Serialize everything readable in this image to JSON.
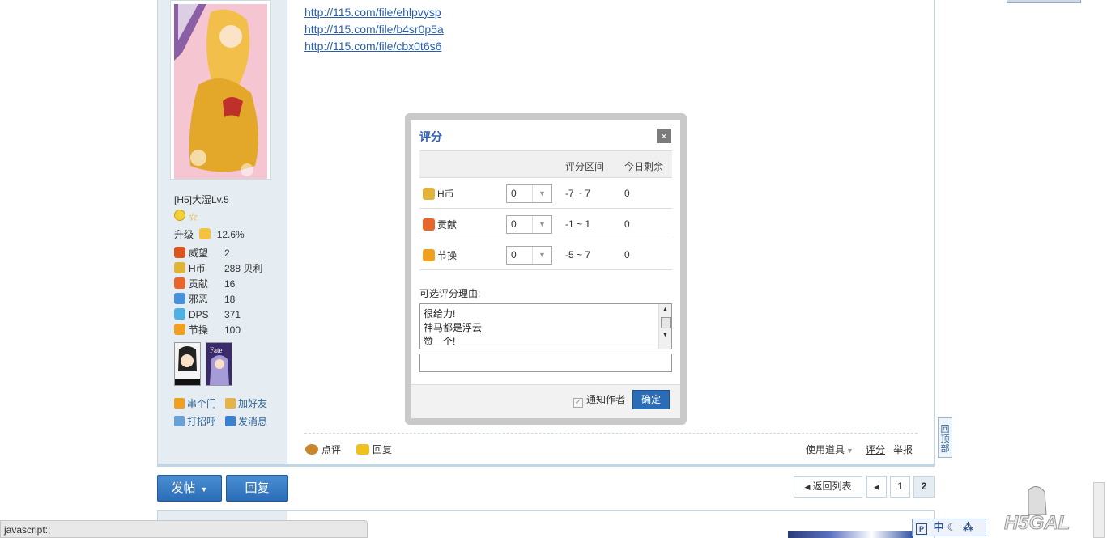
{
  "post": {
    "links": [
      "http://115.com/file/ehlpvysp",
      "http://115.com/file/b4sr0p5a",
      "http://115.com/file/cbx0t6s6"
    ]
  },
  "user": {
    "name": "[H5]大湿Lv.5",
    "upgrade_label": "升级",
    "upgrade_pct": "12.6%",
    "stats": [
      {
        "label": "威望",
        "value": "2",
        "icon": "crown-icon",
        "color": "#d9541e"
      },
      {
        "label": "H币",
        "value": "288 贝利",
        "icon": "coins-icon",
        "color": "#e0b43a"
      },
      {
        "label": "贡献",
        "value": "16",
        "icon": "heart-icon",
        "color": "#e8662b"
      },
      {
        "label": "邪恶",
        "value": "18",
        "icon": "house-icon",
        "color": "#4a90d9"
      },
      {
        "label": "DPS",
        "value": "371",
        "icon": "star-icon",
        "color": "#4fb0e6"
      },
      {
        "label": "节操",
        "value": "100",
        "icon": "bulb-icon",
        "color": "#f0a020"
      }
    ],
    "actions": {
      "home": "串个门",
      "add_friend": "加好友",
      "greet": "打招呼",
      "message": "发消息"
    }
  },
  "post_actions": {
    "comment": "点评",
    "reply": "回复",
    "use_item": "使用道具",
    "rate": "评分",
    "report": "举报"
  },
  "buttons": {
    "new_thread": "发帖",
    "reply": "回复"
  },
  "pagination": {
    "back": "返回列表",
    "pages": [
      "1",
      "2"
    ],
    "current": "2"
  },
  "dialog": {
    "title": "评分",
    "close": "×",
    "col_range": "评分区间",
    "col_remaining": "今日剩余",
    "rows": [
      {
        "label": "H币",
        "value": "0",
        "range": "-7 ~ 7",
        "remaining": "0",
        "icon": "coins-icon"
      },
      {
        "label": "贡献",
        "value": "0",
        "range": "-1 ~ 1",
        "remaining": "0",
        "icon": "heart-icon"
      },
      {
        "label": "节操",
        "value": "0",
        "range": "-5 ~ 7",
        "remaining": "0",
        "icon": "bulb-icon"
      }
    ],
    "reason_label": "可选评分理由:",
    "reasons": [
      "很给力!",
      "神马都是浮云",
      "赞一个!"
    ],
    "notify": "通知作者",
    "notify_checked": true,
    "confirm": "确定"
  },
  "to_top": "回顶部",
  "status_bar": "javascript:;",
  "ime": "中"
}
